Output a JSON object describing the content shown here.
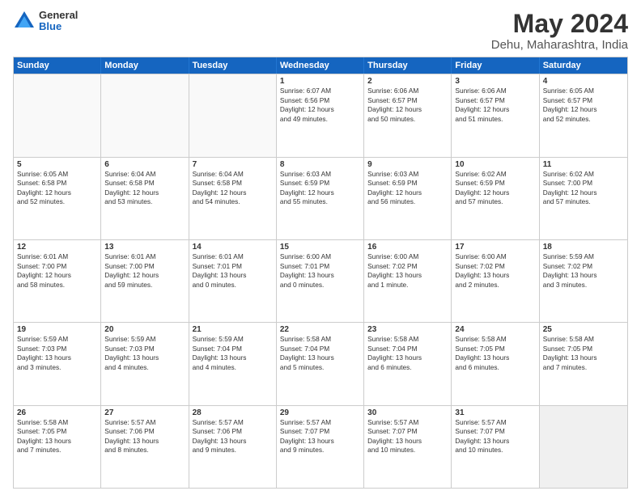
{
  "logo": {
    "general": "General",
    "blue": "Blue"
  },
  "title": "May 2024",
  "subtitle": "Dehu, Maharashtra, India",
  "header_days": [
    "Sunday",
    "Monday",
    "Tuesday",
    "Wednesday",
    "Thursday",
    "Friday",
    "Saturday"
  ],
  "rows": [
    [
      {
        "day": "",
        "lines": [],
        "empty": true
      },
      {
        "day": "",
        "lines": [],
        "empty": true
      },
      {
        "day": "",
        "lines": [],
        "empty": true
      },
      {
        "day": "1",
        "lines": [
          "Sunrise: 6:07 AM",
          "Sunset: 6:56 PM",
          "Daylight: 12 hours",
          "and 49 minutes."
        ]
      },
      {
        "day": "2",
        "lines": [
          "Sunrise: 6:06 AM",
          "Sunset: 6:57 PM",
          "Daylight: 12 hours",
          "and 50 minutes."
        ]
      },
      {
        "day": "3",
        "lines": [
          "Sunrise: 6:06 AM",
          "Sunset: 6:57 PM",
          "Daylight: 12 hours",
          "and 51 minutes."
        ]
      },
      {
        "day": "4",
        "lines": [
          "Sunrise: 6:05 AM",
          "Sunset: 6:57 PM",
          "Daylight: 12 hours",
          "and 52 minutes."
        ]
      }
    ],
    [
      {
        "day": "5",
        "lines": [
          "Sunrise: 6:05 AM",
          "Sunset: 6:58 PM",
          "Daylight: 12 hours",
          "and 52 minutes."
        ]
      },
      {
        "day": "6",
        "lines": [
          "Sunrise: 6:04 AM",
          "Sunset: 6:58 PM",
          "Daylight: 12 hours",
          "and 53 minutes."
        ]
      },
      {
        "day": "7",
        "lines": [
          "Sunrise: 6:04 AM",
          "Sunset: 6:58 PM",
          "Daylight: 12 hours",
          "and 54 minutes."
        ]
      },
      {
        "day": "8",
        "lines": [
          "Sunrise: 6:03 AM",
          "Sunset: 6:59 PM",
          "Daylight: 12 hours",
          "and 55 minutes."
        ]
      },
      {
        "day": "9",
        "lines": [
          "Sunrise: 6:03 AM",
          "Sunset: 6:59 PM",
          "Daylight: 12 hours",
          "and 56 minutes."
        ]
      },
      {
        "day": "10",
        "lines": [
          "Sunrise: 6:02 AM",
          "Sunset: 6:59 PM",
          "Daylight: 12 hours",
          "and 57 minutes."
        ]
      },
      {
        "day": "11",
        "lines": [
          "Sunrise: 6:02 AM",
          "Sunset: 7:00 PM",
          "Daylight: 12 hours",
          "and 57 minutes."
        ]
      }
    ],
    [
      {
        "day": "12",
        "lines": [
          "Sunrise: 6:01 AM",
          "Sunset: 7:00 PM",
          "Daylight: 12 hours",
          "and 58 minutes."
        ]
      },
      {
        "day": "13",
        "lines": [
          "Sunrise: 6:01 AM",
          "Sunset: 7:00 PM",
          "Daylight: 12 hours",
          "and 59 minutes."
        ]
      },
      {
        "day": "14",
        "lines": [
          "Sunrise: 6:01 AM",
          "Sunset: 7:01 PM",
          "Daylight: 13 hours",
          "and 0 minutes."
        ]
      },
      {
        "day": "15",
        "lines": [
          "Sunrise: 6:00 AM",
          "Sunset: 7:01 PM",
          "Daylight: 13 hours",
          "and 0 minutes."
        ]
      },
      {
        "day": "16",
        "lines": [
          "Sunrise: 6:00 AM",
          "Sunset: 7:02 PM",
          "Daylight: 13 hours",
          "and 1 minute."
        ]
      },
      {
        "day": "17",
        "lines": [
          "Sunrise: 6:00 AM",
          "Sunset: 7:02 PM",
          "Daylight: 13 hours",
          "and 2 minutes."
        ]
      },
      {
        "day": "18",
        "lines": [
          "Sunrise: 5:59 AM",
          "Sunset: 7:02 PM",
          "Daylight: 13 hours",
          "and 3 minutes."
        ]
      }
    ],
    [
      {
        "day": "19",
        "lines": [
          "Sunrise: 5:59 AM",
          "Sunset: 7:03 PM",
          "Daylight: 13 hours",
          "and 3 minutes."
        ]
      },
      {
        "day": "20",
        "lines": [
          "Sunrise: 5:59 AM",
          "Sunset: 7:03 PM",
          "Daylight: 13 hours",
          "and 4 minutes."
        ]
      },
      {
        "day": "21",
        "lines": [
          "Sunrise: 5:59 AM",
          "Sunset: 7:04 PM",
          "Daylight: 13 hours",
          "and 4 minutes."
        ]
      },
      {
        "day": "22",
        "lines": [
          "Sunrise: 5:58 AM",
          "Sunset: 7:04 PM",
          "Daylight: 13 hours",
          "and 5 minutes."
        ]
      },
      {
        "day": "23",
        "lines": [
          "Sunrise: 5:58 AM",
          "Sunset: 7:04 PM",
          "Daylight: 13 hours",
          "and 6 minutes."
        ]
      },
      {
        "day": "24",
        "lines": [
          "Sunrise: 5:58 AM",
          "Sunset: 7:05 PM",
          "Daylight: 13 hours",
          "and 6 minutes."
        ]
      },
      {
        "day": "25",
        "lines": [
          "Sunrise: 5:58 AM",
          "Sunset: 7:05 PM",
          "Daylight: 13 hours",
          "and 7 minutes."
        ]
      }
    ],
    [
      {
        "day": "26",
        "lines": [
          "Sunrise: 5:58 AM",
          "Sunset: 7:05 PM",
          "Daylight: 13 hours",
          "and 7 minutes."
        ]
      },
      {
        "day": "27",
        "lines": [
          "Sunrise: 5:57 AM",
          "Sunset: 7:06 PM",
          "Daylight: 13 hours",
          "and 8 minutes."
        ]
      },
      {
        "day": "28",
        "lines": [
          "Sunrise: 5:57 AM",
          "Sunset: 7:06 PM",
          "Daylight: 13 hours",
          "and 9 minutes."
        ]
      },
      {
        "day": "29",
        "lines": [
          "Sunrise: 5:57 AM",
          "Sunset: 7:07 PM",
          "Daylight: 13 hours",
          "and 9 minutes."
        ]
      },
      {
        "day": "30",
        "lines": [
          "Sunrise: 5:57 AM",
          "Sunset: 7:07 PM",
          "Daylight: 13 hours",
          "and 10 minutes."
        ]
      },
      {
        "day": "31",
        "lines": [
          "Sunrise: 5:57 AM",
          "Sunset: 7:07 PM",
          "Daylight: 13 hours",
          "and 10 minutes."
        ]
      },
      {
        "day": "",
        "lines": [],
        "empty": true,
        "shaded": true
      }
    ]
  ]
}
